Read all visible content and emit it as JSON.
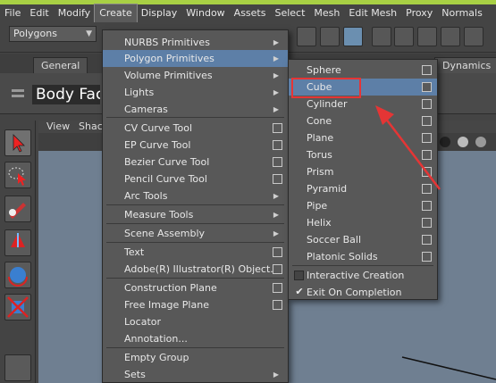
{
  "menubar": {
    "items": [
      "File",
      "Edit",
      "Modify",
      "Create",
      "Display",
      "Window",
      "Assets",
      "Select",
      "Mesh",
      "Edit Mesh",
      "Proxy",
      "Normals"
    ]
  },
  "toolbar": {
    "mode_select": "Polygons"
  },
  "shelf": {
    "tabs": [
      "General",
      "Dynamics"
    ],
    "label": "Body Face"
  },
  "viewport": {
    "menu": [
      "View",
      "Shac"
    ]
  },
  "create_menu": {
    "items": [
      {
        "label": "NURBS Primitives",
        "submenu": true
      },
      {
        "label": "Polygon Primitives",
        "submenu": true,
        "highlighted": true
      },
      {
        "label": "Volume Primitives",
        "submenu": true
      },
      {
        "label": "Lights",
        "submenu": true
      },
      {
        "label": "Cameras",
        "submenu": true
      },
      {
        "label": "CV Curve Tool",
        "option_box": true
      },
      {
        "label": "EP Curve Tool",
        "option_box": true
      },
      {
        "label": "Bezier Curve Tool",
        "option_box": true
      },
      {
        "label": "Pencil Curve Tool",
        "option_box": true
      },
      {
        "label": "Arc Tools",
        "submenu": true
      },
      {
        "label": "Measure Tools",
        "submenu": true
      },
      {
        "label": "Scene Assembly",
        "submenu": true
      },
      {
        "label": "Text",
        "option_box": true
      },
      {
        "label": "Adobe(R) Illustrator(R) Object...",
        "option_box": true
      },
      {
        "label": "Construction Plane",
        "option_box": true
      },
      {
        "label": "Free Image Plane",
        "option_box": true
      },
      {
        "label": "Locator"
      },
      {
        "label": "Annotation..."
      },
      {
        "label": "Empty Group"
      },
      {
        "label": "Sets",
        "submenu": true
      }
    ]
  },
  "polygon_primitives_menu": {
    "items": [
      {
        "label": "Sphere",
        "option_box": true
      },
      {
        "label": "Cube",
        "option_box": true,
        "highlighted": true
      },
      {
        "label": "Cylinder",
        "option_box": true
      },
      {
        "label": "Cone",
        "option_box": true
      },
      {
        "label": "Plane",
        "option_box": true
      },
      {
        "label": "Torus",
        "option_box": true
      },
      {
        "label": "Prism",
        "option_box": true
      },
      {
        "label": "Pyramid",
        "option_box": true
      },
      {
        "label": "Pipe",
        "option_box": true
      },
      {
        "label": "Helix",
        "option_box": true
      },
      {
        "label": "Soccer Ball",
        "option_box": true
      },
      {
        "label": "Platonic Solids",
        "option_box": true
      }
    ],
    "toggles": [
      {
        "label": "Interactive Creation",
        "checked": false
      },
      {
        "label": "Exit On Completion",
        "checked": true
      }
    ]
  },
  "colors": {
    "accent_highlight": "#5d7fa7",
    "annotation_red": "#e53535",
    "top_strip": "#a8d044"
  }
}
